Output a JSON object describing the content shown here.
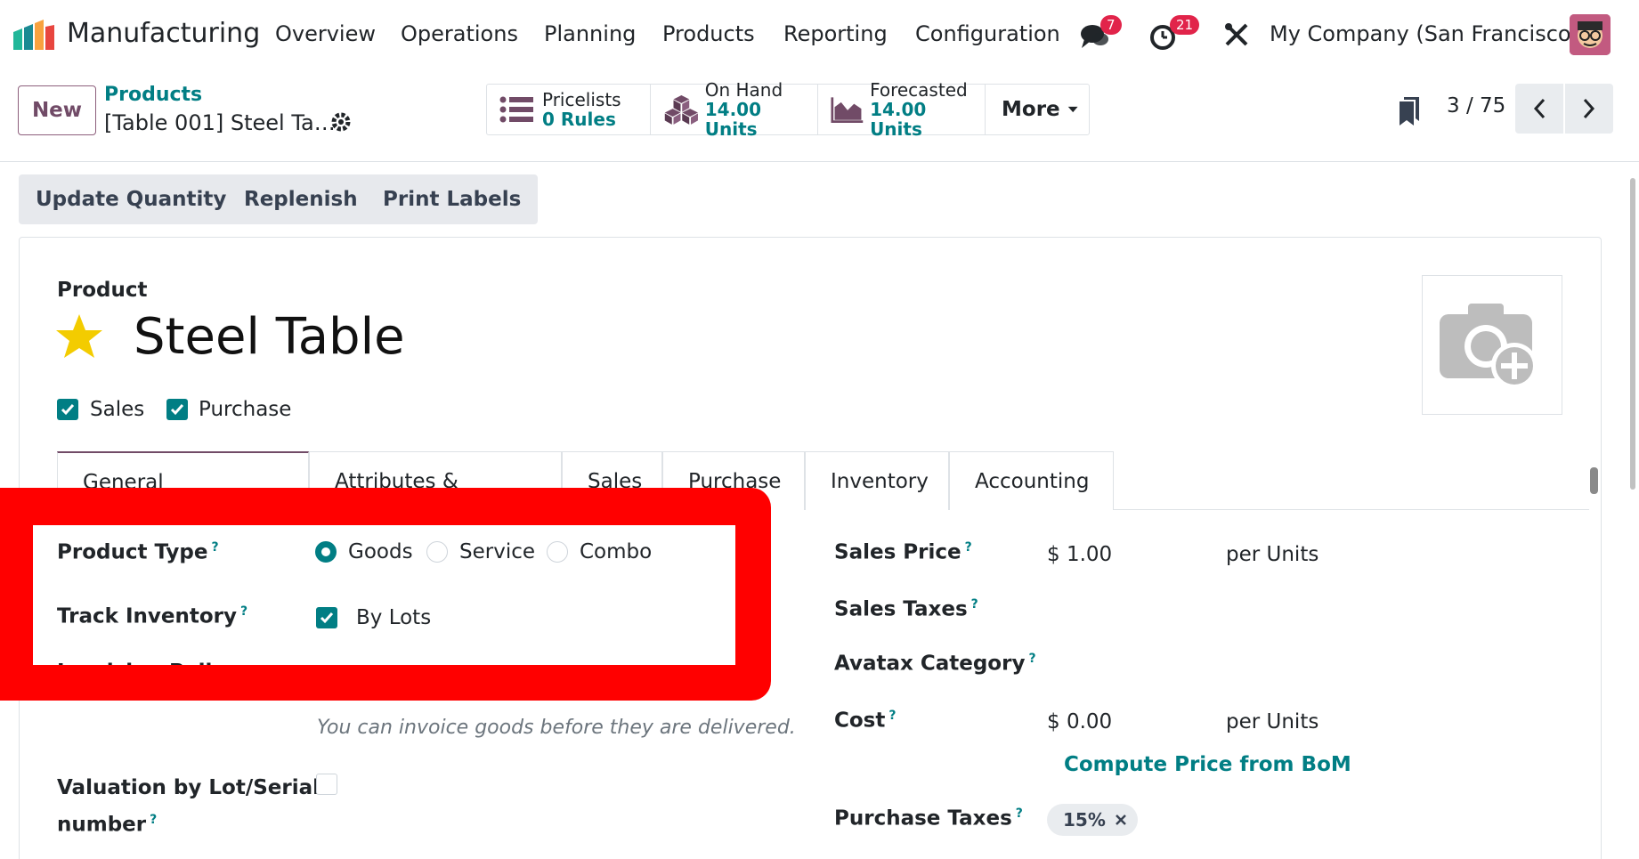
{
  "navbar": {
    "app_name": "Manufacturing",
    "menus": [
      "Overview",
      "Operations",
      "Planning",
      "Products",
      "Reporting",
      "Configuration"
    ],
    "messages_badge": "7",
    "activities_badge": "21",
    "company": "My Company (San Francisco)"
  },
  "control": {
    "new_label": "New",
    "breadcrumb_parent": "Products",
    "breadcrumb_record": "[Table 001] Steel Ta…",
    "smart_buttons": [
      {
        "line1": "Pricelists",
        "line2": "0  Rules",
        "icon": "list-icon"
      },
      {
        "line1": "On Hand",
        "line2": "14.00 Units",
        "icon": "cubes-icon"
      },
      {
        "line1": "Forecasted",
        "line2": "14.00 Units",
        "icon": "area-chart-icon"
      }
    ],
    "more_label": "More",
    "pager": "3 / 75"
  },
  "actions": [
    "Update Quantity",
    "Replenish",
    "Print Labels"
  ],
  "product": {
    "label": "Product",
    "name": "Steel Table",
    "favorite": true,
    "sales_label": "Sales",
    "purchase_label": "Purchase",
    "sales_checked": true,
    "purchase_checked": true
  },
  "tabs": [
    "General Information",
    "Attributes & Variants",
    "Sales",
    "Purchase",
    "Inventory",
    "Accounting"
  ],
  "active_tab": "General Information",
  "form": {
    "product_type_label": "Product Type",
    "product_type_options": [
      "Goods",
      "Service",
      "Combo"
    ],
    "product_type_selected": "Goods",
    "track_inventory_label": "Track Inventory",
    "track_inventory_value": "By Lots",
    "partial_label": "Invoicing Policy",
    "hint": "You can invoice goods before they are delivered.",
    "valuation_label_1": "Valuation by Lot/Serial",
    "valuation_label_2": "number",
    "sales_price_label": "Sales Price",
    "sales_price_value": "$ 1.00",
    "sales_price_unit": "per Units",
    "sales_taxes_label": "Sales Taxes",
    "avatax_label": "Avatax Category",
    "cost_label": "Cost",
    "cost_value": "$ 0.00",
    "cost_unit": "per Units",
    "compute_link": "Compute Price from BoM",
    "purchase_taxes_label": "Purchase Taxes",
    "purchase_tax_tag": "15%"
  },
  "help_mark": "?",
  "colors": {
    "accent": "#017e84",
    "brand": "#714b67",
    "highlight": "#ff0000",
    "badge": "#e1244a"
  }
}
